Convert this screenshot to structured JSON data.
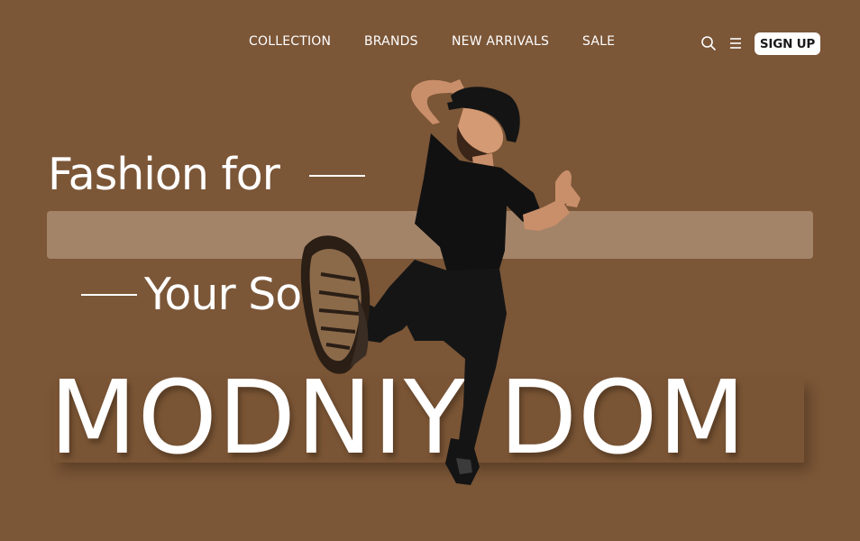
{
  "nav": {
    "items": [
      "COLLECTION",
      "BRANDS",
      "NEW ARRIVALS",
      "SALE"
    ],
    "signup_label": "SIGN UP"
  },
  "hero": {
    "line1": "Fashion for",
    "line2": "Your Soul",
    "brand": "MODNIY DOM"
  },
  "colors": {
    "background": "#7b5637",
    "text": "#ffffff",
    "search_bar": "#b4967d",
    "button_bg": "#ffffff"
  },
  "icons": [
    "search-icon",
    "menu-icon"
  ]
}
